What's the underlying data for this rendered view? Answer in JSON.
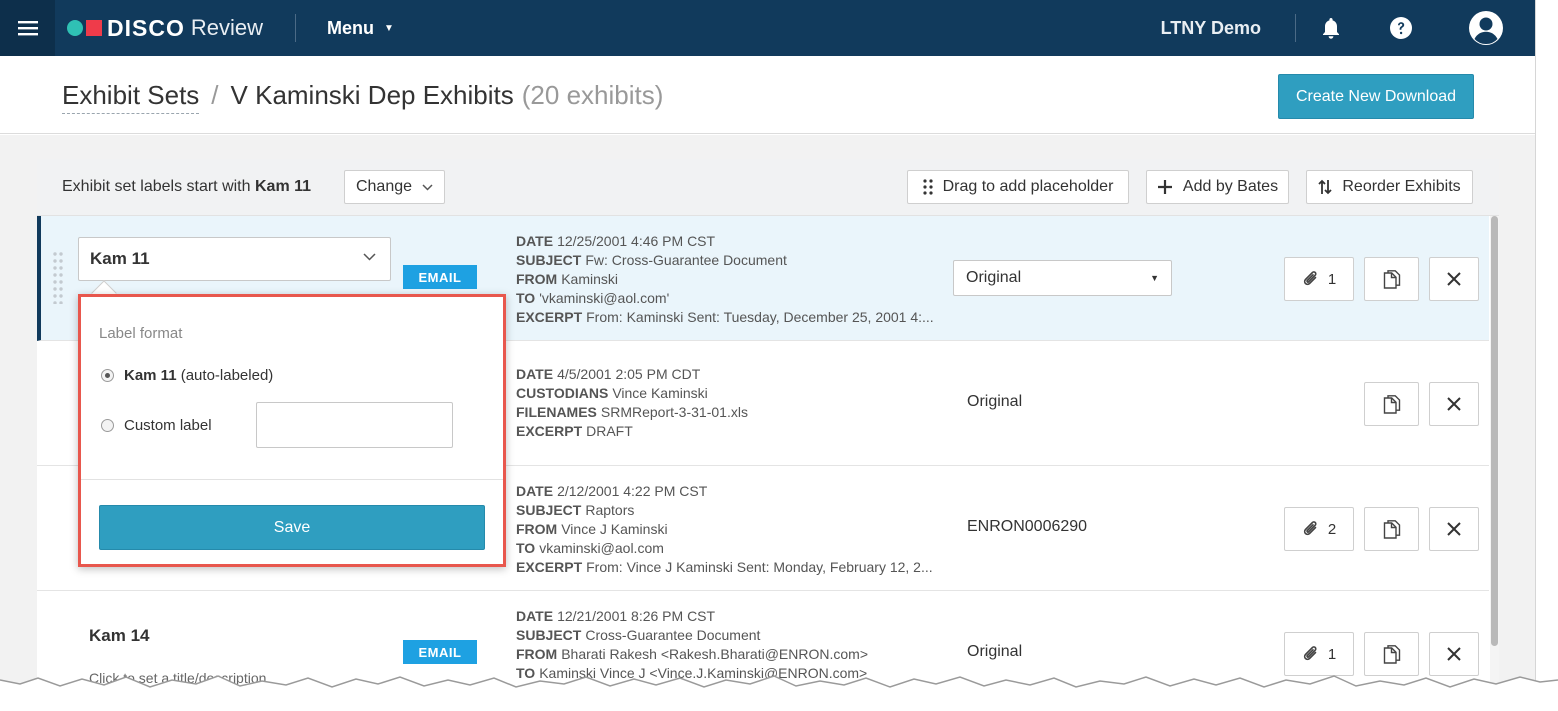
{
  "app": {
    "brand": "DISCO",
    "product": "Review",
    "menu_label": "Menu",
    "org_name": "LTNY Demo"
  },
  "header": {
    "breadcrumb_root": "Exhibit Sets",
    "separator": "/",
    "set_name": "V Kaminski Dep Exhibits",
    "exhibit_count": "(20 exhibits)",
    "create_button": "Create New Download"
  },
  "toolbar": {
    "labels_prefix": "Exhibit set labels start with",
    "labels_start": "Kam 11",
    "change_button": "Change",
    "drag_placeholder": "Drag to add placeholder",
    "add_by_bates": "Add by Bates",
    "reorder": "Reorder Exhibits"
  },
  "rows": [
    {
      "label": "Kam 11",
      "badge": "EMAIL",
      "meta": [
        {
          "key": "DATE",
          "value": "12/25/2001 4:46 PM CST"
        },
        {
          "key": "SUBJECT",
          "value": "Fw: Cross-Guarantee Document"
        },
        {
          "key": "FROM",
          "value": "Kaminski"
        },
        {
          "key": "TO",
          "value": "'vkaminski@aol.com'"
        },
        {
          "key": "EXCERPT",
          "value": "From: Kaminski Sent: Tuesday, December 25, 2001 4:..."
        }
      ],
      "download": "Original",
      "attachments": "1"
    },
    {
      "label": "",
      "badge": "",
      "meta": [
        {
          "key": "DATE",
          "value": "4/5/2001 2:05 PM CDT"
        },
        {
          "key": "CUSTODIANS",
          "value": "Vince Kaminski"
        },
        {
          "key": "FILENAMES",
          "value": "SRMReport-3-31-01.xls"
        },
        {
          "key": "EXCERPT",
          "value": "DRAFT"
        }
      ],
      "download": "Original",
      "attachments": ""
    },
    {
      "label": "",
      "badge": "",
      "meta": [
        {
          "key": "DATE",
          "value": "2/12/2001 4:22 PM CST"
        },
        {
          "key": "SUBJECT",
          "value": "Raptors"
        },
        {
          "key": "FROM",
          "value": "Vince J Kaminski"
        },
        {
          "key": "TO",
          "value": "vkaminski@aol.com"
        },
        {
          "key": "EXCERPT",
          "value": "From: Vince J Kaminski Sent: Monday, February 12, 2..."
        }
      ],
      "download": "ENRON0006290",
      "attachments": "2"
    },
    {
      "label": "Kam 14",
      "description": "Click to set a title/description",
      "badge": "EMAIL",
      "meta": [
        {
          "key": "DATE",
          "value": "12/21/2001 8:26 PM CST"
        },
        {
          "key": "SUBJECT",
          "value": "Cross-Guarantee Document"
        },
        {
          "key": "FROM",
          "value": "Bharati Rakesh <Rakesh.Bharati@ENRON.com>"
        },
        {
          "key": "TO",
          "value": "Kaminski Vince J <Vince.J.Kaminski@ENRON.com>"
        }
      ],
      "download": "Original",
      "attachments": "1"
    }
  ],
  "popup": {
    "title": "Label format",
    "auto_label": "Kam 11",
    "auto_suffix": "(auto-labeled)",
    "custom_label": "Custom label",
    "custom_value": "",
    "save_button": "Save"
  },
  "colors": {
    "topbar": "#113a5c",
    "accent": "#2f9ec0",
    "badge": "#1ea1e2",
    "highlight_border": "#e8574d",
    "active_row": "#eaf5fb"
  }
}
